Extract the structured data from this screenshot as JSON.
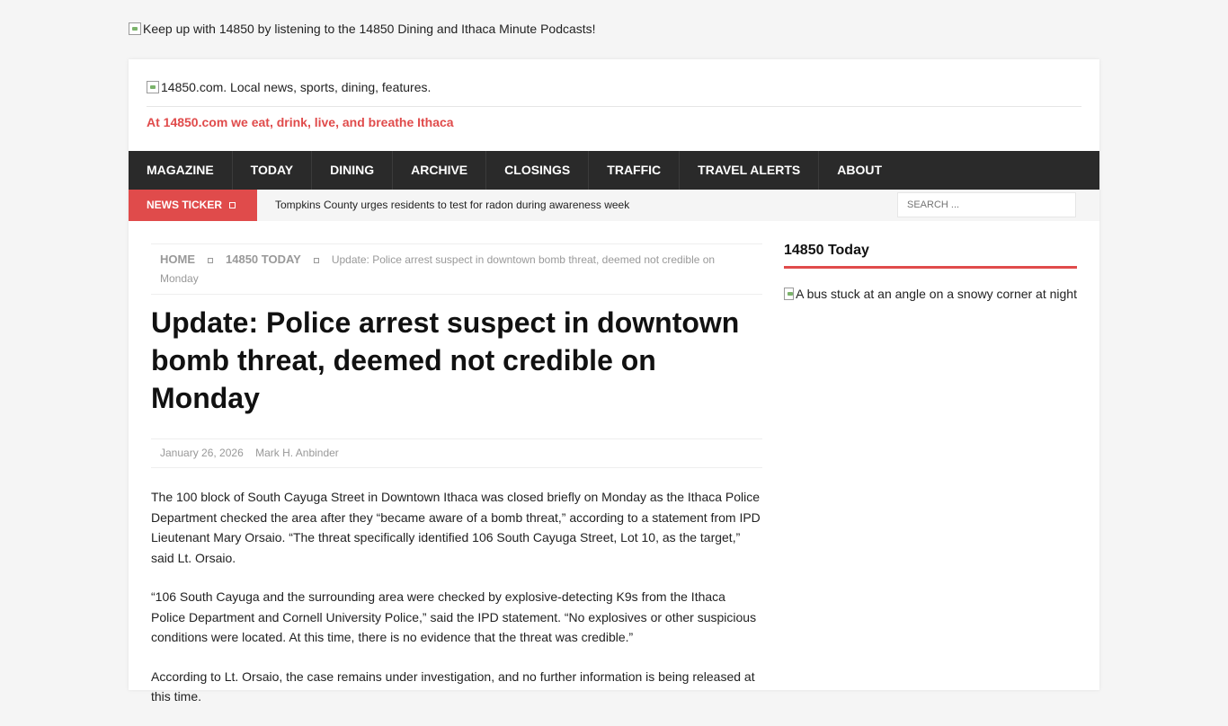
{
  "top_banner": {
    "alt_text": "Keep up with 14850 by listening to the 14850 Dining and Ithaca Minute Podcasts!"
  },
  "header": {
    "logo_alt": "14850.com. Local news, sports, dining, features.",
    "tagline": "At 14850.com we eat, drink, live, and breathe Ithaca"
  },
  "nav": {
    "items": [
      {
        "label": "MAGAZINE"
      },
      {
        "label": "TODAY"
      },
      {
        "label": "DINING"
      },
      {
        "label": "ARCHIVE"
      },
      {
        "label": "CLOSINGS"
      },
      {
        "label": "TRAFFIC"
      },
      {
        "label": "TRAVEL ALERTS"
      },
      {
        "label": "ABOUT"
      }
    ]
  },
  "ticker": {
    "label": "NEWS TICKER",
    "headline": "Tompkins County urges residents to test for radon during awareness week"
  },
  "search": {
    "placeholder": "SEARCH ..."
  },
  "breadcrumb": {
    "home": "HOME",
    "section": "14850 TODAY",
    "current": "Update: Police arrest suspect in downtown bomb threat, deemed not credible on Monday"
  },
  "article": {
    "title": "Update: Police arrest suspect in downtown bomb threat, deemed not credible on Monday",
    "date": "January 26, 2026",
    "author": "Mark H. Anbinder",
    "paragraphs": [
      "The 100 block of South Cayuga Street in Downtown Ithaca was closed briefly on Monday as the Ithaca Police Department checked the area after they “became aware of a bomb threat,” according to a statement from IPD Lieutenant Mary Orsaio. “The threat specifically identified 106 South Cayuga Street, Lot 10, as the target,” said Lt. Orsaio.",
      "“106 South Cayuga and the surrounding area were checked by explosive-detecting K9s from the Ithaca Police Department and Cornell University Police,” said the IPD statement. “No explosives or other suspicious conditions were located. At this time, there is no evidence that the threat was credible.”",
      "According to Lt. Orsaio, the case remains under investigation, and no further information is being released at this time."
    ]
  },
  "sidebar": {
    "widget_title": "14850 Today",
    "image_alt": "A bus stuck at an angle on a snowy corner at night"
  },
  "colors": {
    "accent": "#e04b4b",
    "nav_bg": "#2a2a2a",
    "page_bg": "#f5f5f5"
  }
}
